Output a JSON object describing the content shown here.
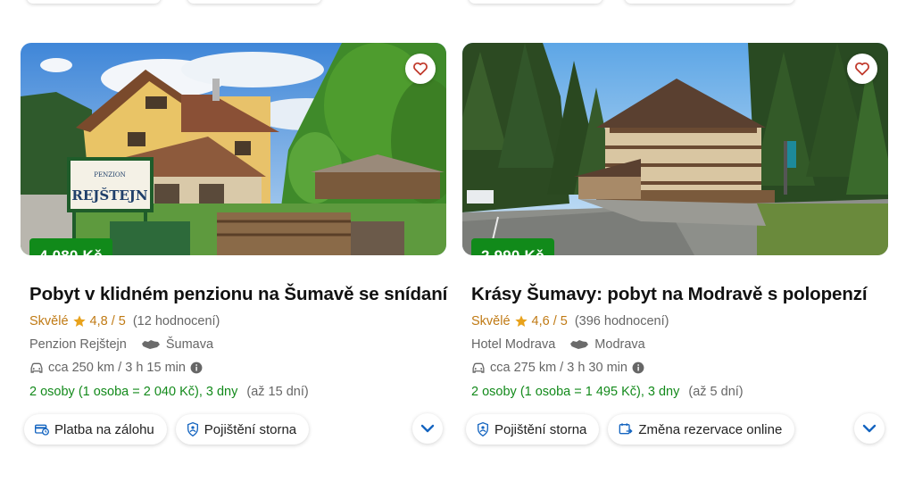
{
  "cards": [
    {
      "price": "4 080 Kč",
      "title": "Pobyt v klidném penzionu na Šumavě se snídaní",
      "rating_word": "Skvělé",
      "rating_score": "4,8 / 5",
      "rating_count": "(12 hodnocení)",
      "hotel": "Penzion Rejštejn",
      "location": "Šumava",
      "drive": "cca 250 km / 3 h 15 min",
      "persons": "2 osoby (1 osoba = 2 040 Kč), 3 dny",
      "availability": "(až 15 dní)",
      "sign_small": "PENZION",
      "sign_big": "REJŠTEJN",
      "chips": [
        "Platba na zálohu",
        "Pojištění storna"
      ],
      "chip_icons": [
        "card-clock-icon",
        "shield-person-icon"
      ]
    },
    {
      "price": "2 990 Kč",
      "title": "Krásy Šumavy: pobyt na Modravě s polopenzí",
      "rating_word": "Skvělé",
      "rating_score": "4,6 / 5",
      "rating_count": "(396 hodnocení)",
      "hotel": "Hotel Modrava",
      "location": "Modrava",
      "drive": "cca 275 km / 3 h 30 min",
      "persons": "2 osoby (1 osoba = 1 495 Kč), 3 dny",
      "availability": "(až 5 dní)",
      "chips": [
        "Pojištění storna",
        "Změna rezervace online"
      ],
      "chip_icons": [
        "shield-person-icon",
        "calendar-swap-icon"
      ]
    }
  ],
  "colors": {
    "price_bg": "#118a1a",
    "rating": "#c07a14",
    "persons": "#138a1b",
    "heart": "#c0392b",
    "accent": "#1565c0"
  }
}
